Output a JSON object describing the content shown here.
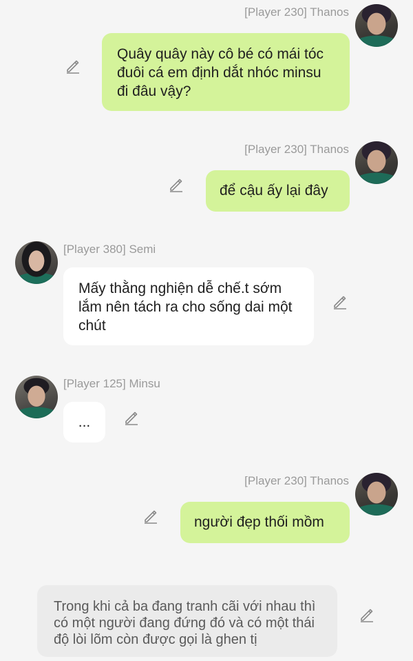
{
  "messages": [
    {
      "sender": "[Player 230] Thanos",
      "text": "Quây quây này cô bé có mái tóc đuôi cá em định dắt nhóc minsu đi đâu vậy?",
      "side": "right"
    },
    {
      "sender": "[Player 230] Thanos",
      "text": "để cậu ấy lại đây",
      "side": "right"
    },
    {
      "sender": "[Player 380] Semi",
      "text": "Mấy thằng nghiện dễ chế.t sớm lắm nên tách ra cho sống dai một chút",
      "side": "left"
    },
    {
      "sender": "[Player 125] Minsu",
      "text": "...",
      "side": "left"
    },
    {
      "sender": "[Player 230] Thanos",
      "text": "người đẹp thối mồm",
      "side": "right"
    }
  ],
  "narration": {
    "text": "Trong khi cả ba đang tranh cãi với nhau thì có một người đang đứng đó và có một thái độ lòi lõm còn được gọi là ghen tị"
  },
  "icons": {
    "edit": "pencil-edit-icon",
    "avatar_thanos": "avatar-thanos",
    "avatar_semi": "avatar-semi",
    "avatar_minsu": "avatar-minsu"
  },
  "colors": {
    "background": "#f5f5f5",
    "self_bubble": "#d4f39a",
    "other_bubble": "#ffffff",
    "narration_bubble": "#ebebeb",
    "sender_name": "#9a9a9a"
  }
}
